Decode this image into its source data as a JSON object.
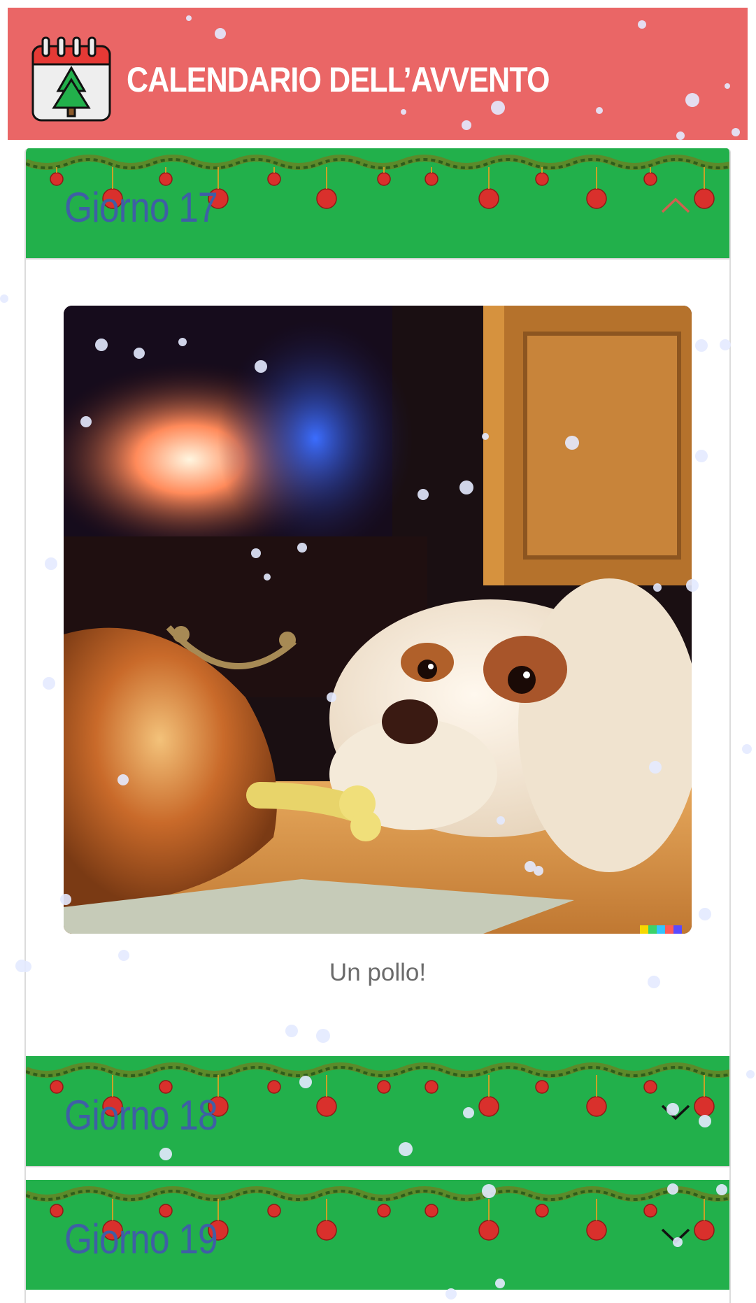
{
  "header": {
    "title": "CALENDARIO DELL’AVVENTO",
    "icon": "advent-calendar-tree-icon",
    "background": "#ea6666"
  },
  "accordion": {
    "header_color": "#22b04b",
    "title_color": "#3f5fa5",
    "items": [
      {
        "label": "Giorno 17",
        "expanded": true,
        "caption": "Un pollo!",
        "image": "dog-looking-at-roast-chicken-by-fireplace"
      },
      {
        "label": "Giorno 18",
        "expanded": false
      },
      {
        "label": "Giorno 19",
        "expanded": false
      }
    ]
  },
  "icons": {
    "expanded": "chevron-up-icon",
    "collapsed": "chevron-down-icon"
  }
}
